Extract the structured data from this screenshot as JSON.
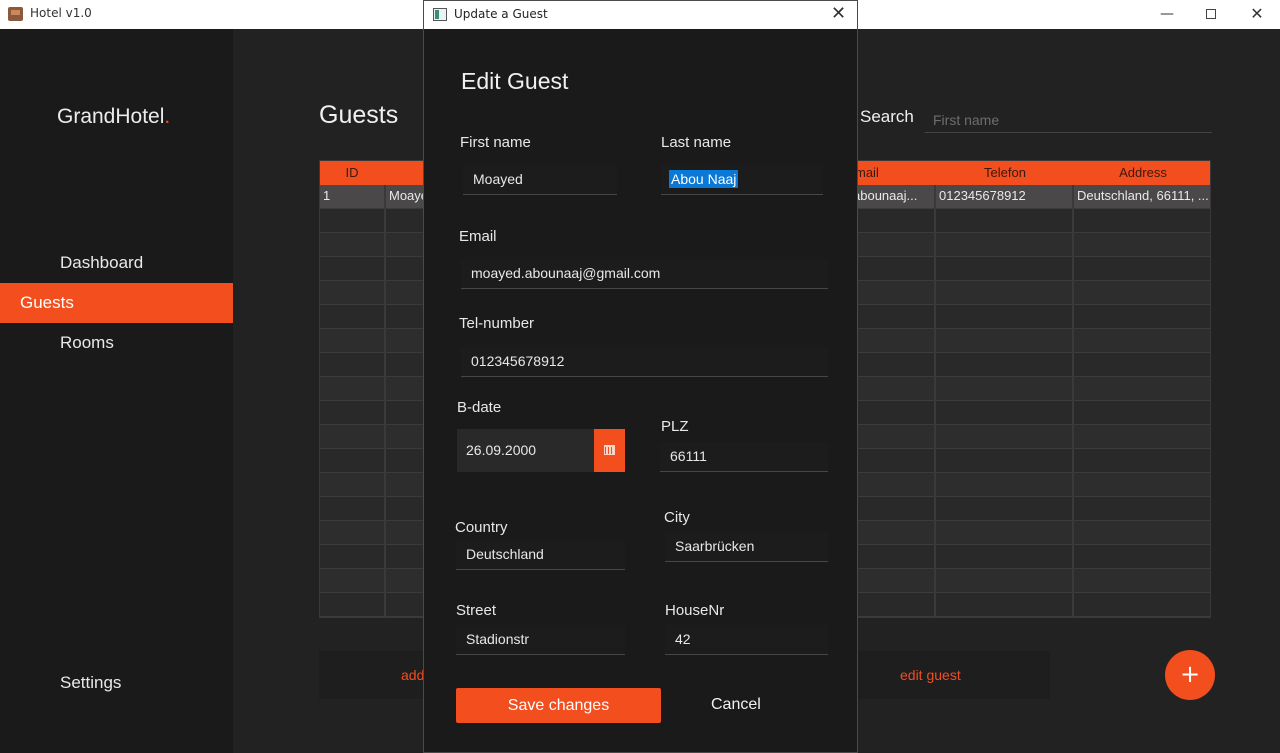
{
  "window": {
    "title": "Hotel v1.0",
    "minimize": "—",
    "close": "✕"
  },
  "sidebar": {
    "logo": "GrandHotel",
    "logo_dot": ".",
    "items": [
      {
        "label": "Dashboard"
      },
      {
        "label": "Guests"
      },
      {
        "label": "Rooms"
      }
    ],
    "settings": "Settings"
  },
  "main": {
    "title": "Guests",
    "search_label": "Search",
    "search_placeholder": "First name",
    "columns": [
      "ID",
      "mail",
      "Telefon",
      "Address"
    ],
    "rows": [
      {
        "id": "1",
        "first": "Moaye",
        "email": "abounaaj...",
        "phone": "012345678912",
        "address": "Deutschland, 66111, ..."
      }
    ],
    "add_label": "add",
    "edit_label": "edit guest",
    "fab": "+"
  },
  "dialog": {
    "window_title": "Update a Guest",
    "close": "✕",
    "heading": "Edit Guest",
    "first_name_label": "First name",
    "first_name": "Moayed",
    "last_name_label": "Last name",
    "last_name": "Abou Naaj",
    "email_label": "Email",
    "email": "moayed.abounaaj@gmail.com",
    "tel_label": "Tel-number",
    "tel": "012345678912",
    "bdate_label": "B-date",
    "bdate": "26.09.2000",
    "plz_label": "PLZ",
    "plz": "66111",
    "country_label": "Country",
    "country": "Deutschland",
    "city_label": "City",
    "city": "Saarbrücken",
    "street_label": "Street",
    "street": "Stadionstr",
    "housenr_label": "HouseNr",
    "housenr": "42",
    "save": "Save changes",
    "cancel": "Cancel"
  },
  "colors": {
    "accent": "#f24e1e",
    "background": "#1b1a1a",
    "selection": "#0a78d7"
  }
}
